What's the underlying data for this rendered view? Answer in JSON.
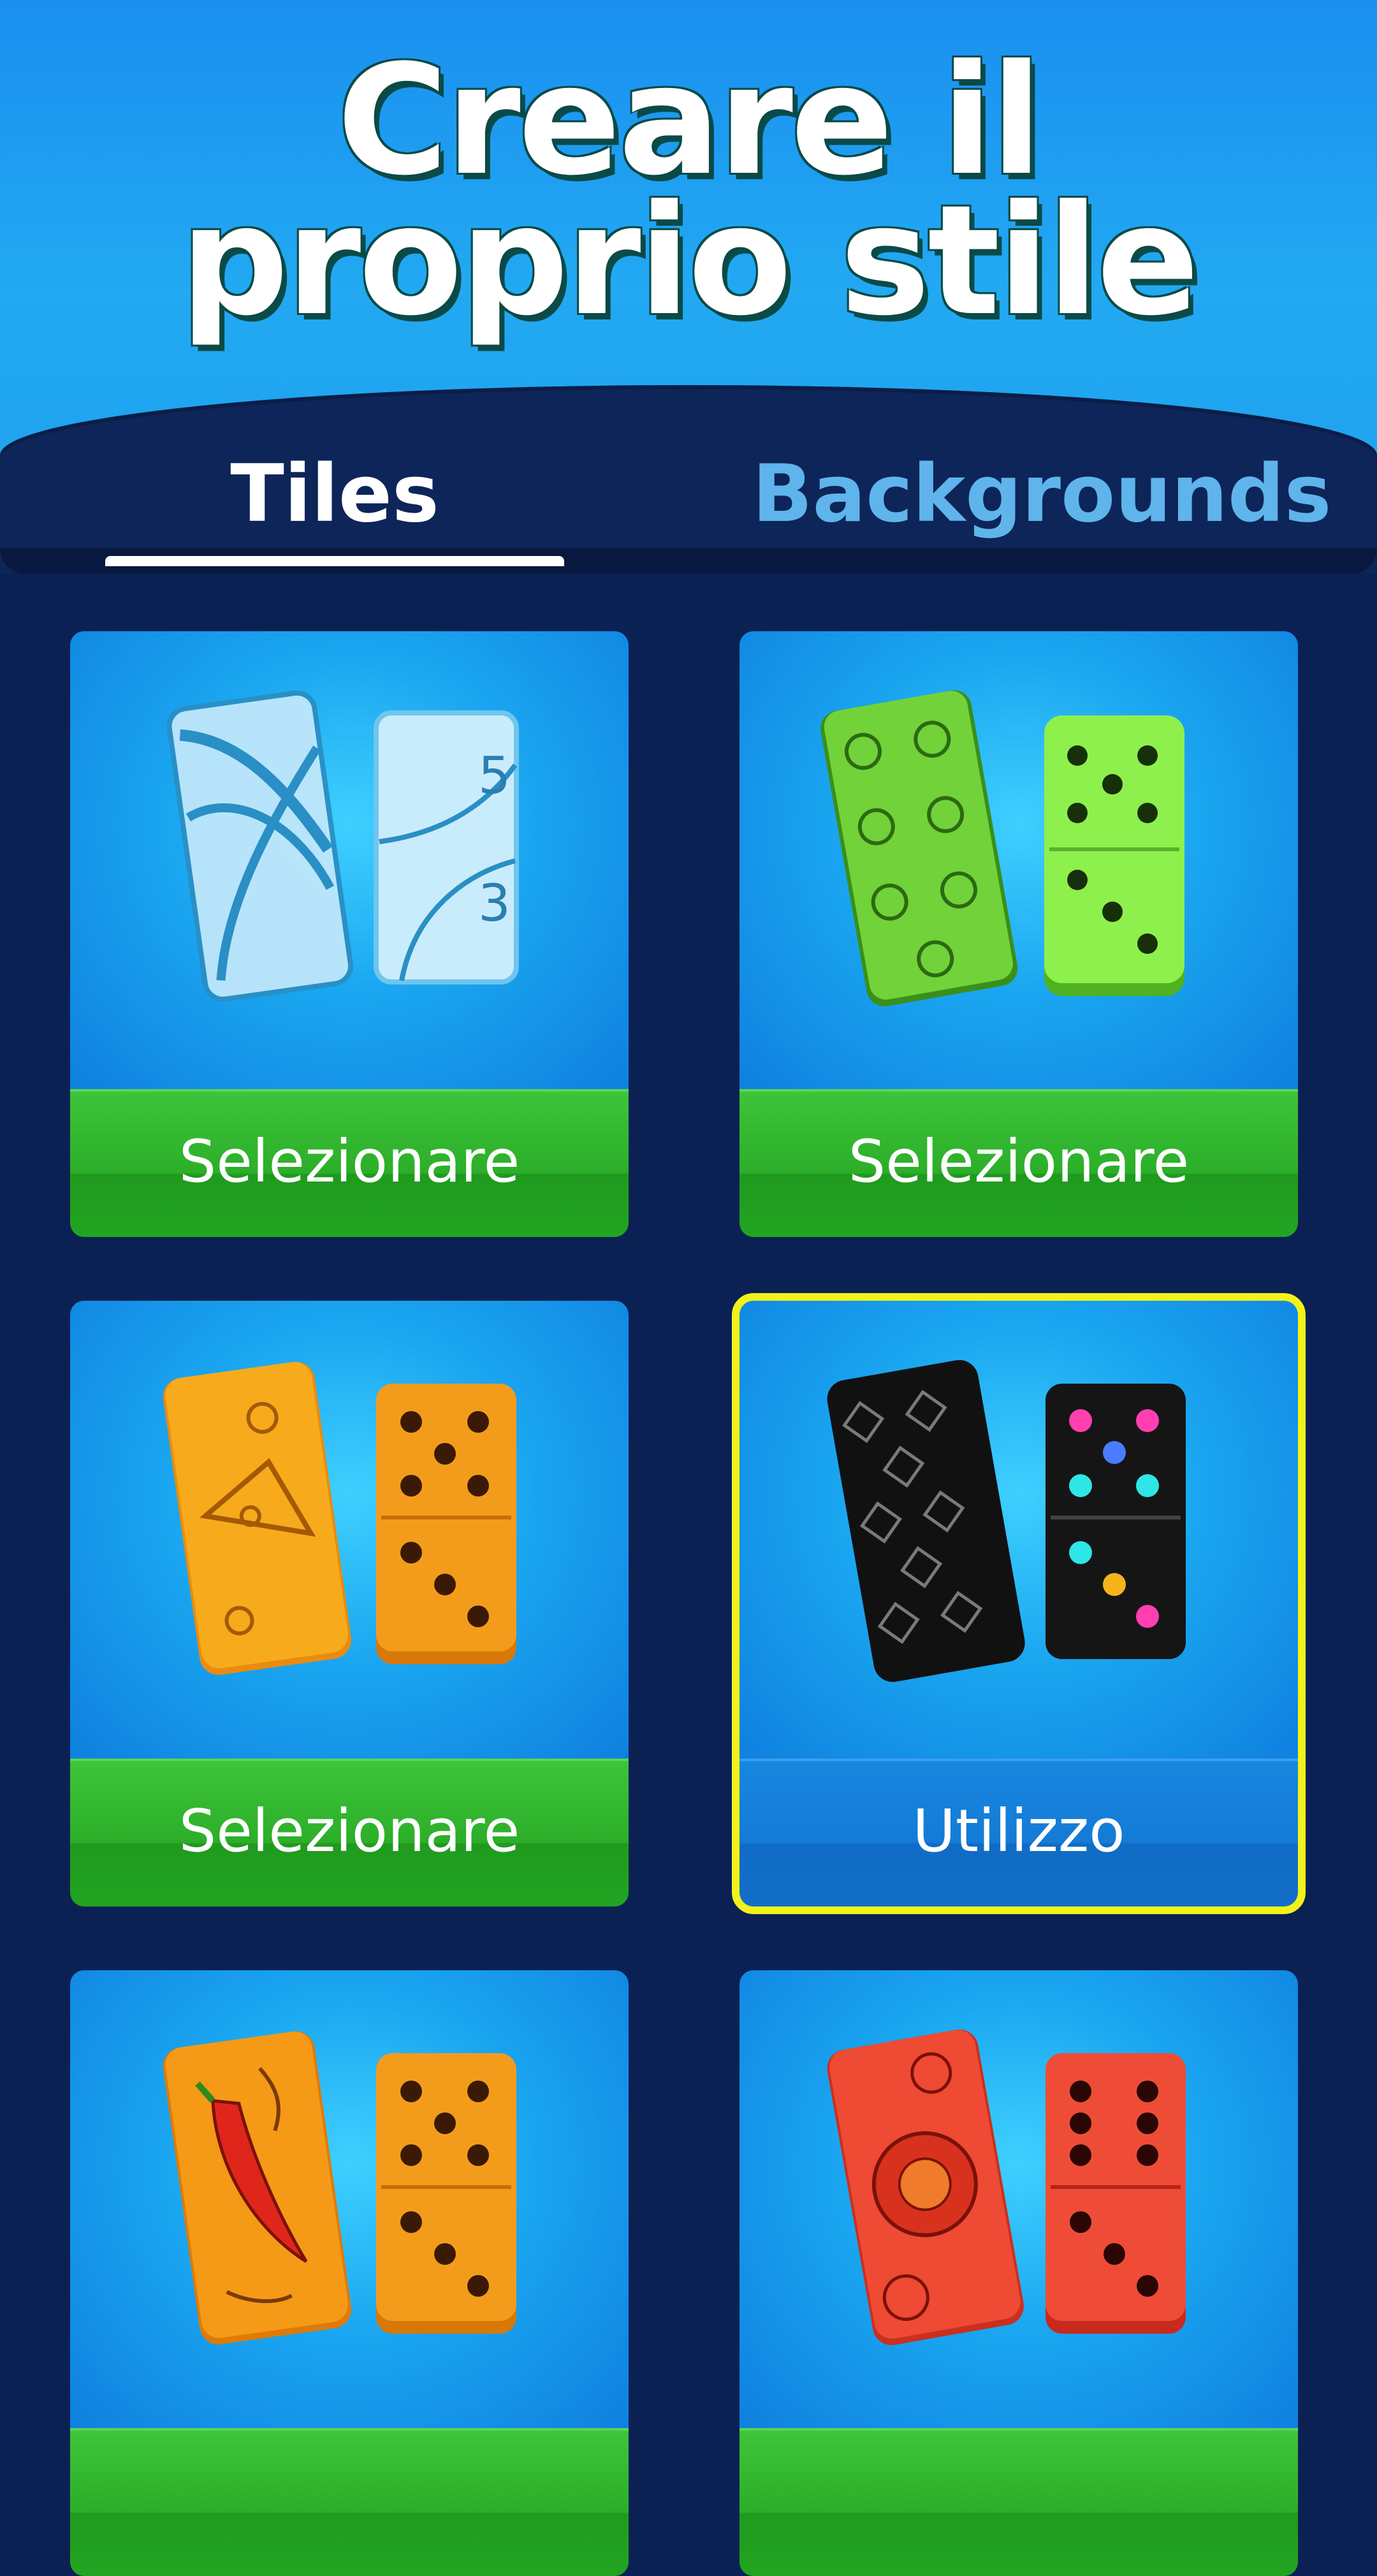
{
  "header": {
    "title_line1": "Creare il",
    "title_line2": "proprio stile"
  },
  "tabs": [
    {
      "label": "Tiles",
      "active": true
    },
    {
      "label": "Backgrounds",
      "active": false
    }
  ],
  "cards": [
    {
      "theme": "classic-blue",
      "button": "Selezionare",
      "selected": false,
      "pips_top": "5",
      "pips_bottom": "3"
    },
    {
      "theme": "green-pattern",
      "button": "Selezionare",
      "selected": false
    },
    {
      "theme": "cheese",
      "button": "Selezionare",
      "selected": false
    },
    {
      "theme": "black-neon",
      "button": "Utilizzo",
      "selected": true
    },
    {
      "theme": "chili-pepper",
      "button": "",
      "selected": false
    },
    {
      "theme": "tomato",
      "button": "",
      "selected": false
    }
  ],
  "colors": {
    "background": "#0b2154",
    "header_sky": "#22a9f2",
    "select_green": "#2cae29",
    "use_blue": "#147bd6",
    "selected_outline": "#f2f21a",
    "inactive_tab": "#5fb4ec"
  }
}
